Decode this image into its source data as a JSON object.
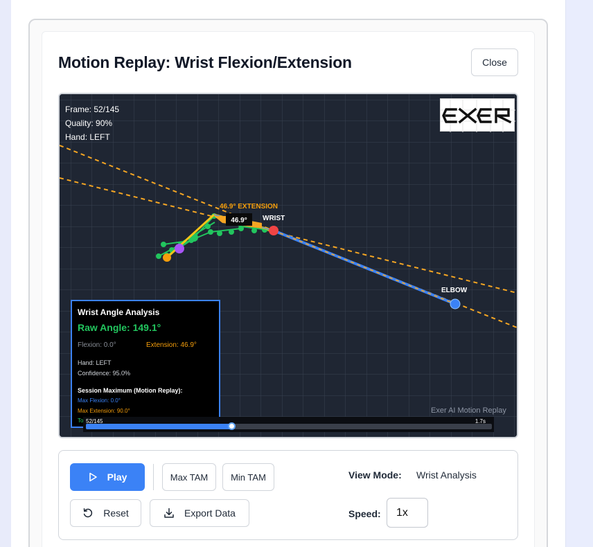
{
  "dialog": {
    "title": "Motion Replay: Wrist Flexion/Extension",
    "close_label": "Close"
  },
  "overlay": {
    "frame": "Frame: 52/145",
    "quality": "Quality: 90%",
    "hand": "Hand: LEFT",
    "angle_badge": "46.9°",
    "extension_label": "46.9° EXTENSION",
    "wrist_label": "WRIST",
    "elbow_label": "ELBOW",
    "watermark": "Exer AI Motion Replay",
    "logo_text": "EXER"
  },
  "analysis": {
    "title": "Wrist Angle Analysis",
    "raw_angle": "Raw Angle: 149.1°",
    "flexion": "Flexion: 0.0°",
    "extension": "Extension: 46.9°",
    "hand": "Hand: LEFT",
    "confidence": "Confidence: 95.0%",
    "session_header": "Session Maximum (Motion Replay):",
    "max_flexion": "Max Flexion: 0.0°",
    "max_extension": "Max Extension: 90.0°",
    "total_partial": "To          90.0°"
  },
  "timeline": {
    "frame_label": "52/145",
    "time_label": "1.7s",
    "progress": 0.359
  },
  "controls": {
    "play_label": "Play",
    "max_tam_label": "Max TAM",
    "min_tam_label": "Min TAM",
    "reset_label": "Reset",
    "export_label": "Export Data",
    "view_mode_label": "View Mode:",
    "view_mode_value": "Wrist Analysis",
    "speed_label": "Speed:",
    "speed_value": "1x"
  },
  "colors": {
    "accent": "#3b82f6",
    "extension": "#f59e0b",
    "raw_angle": "#22c55e",
    "wrist_point": "#ef4444"
  }
}
